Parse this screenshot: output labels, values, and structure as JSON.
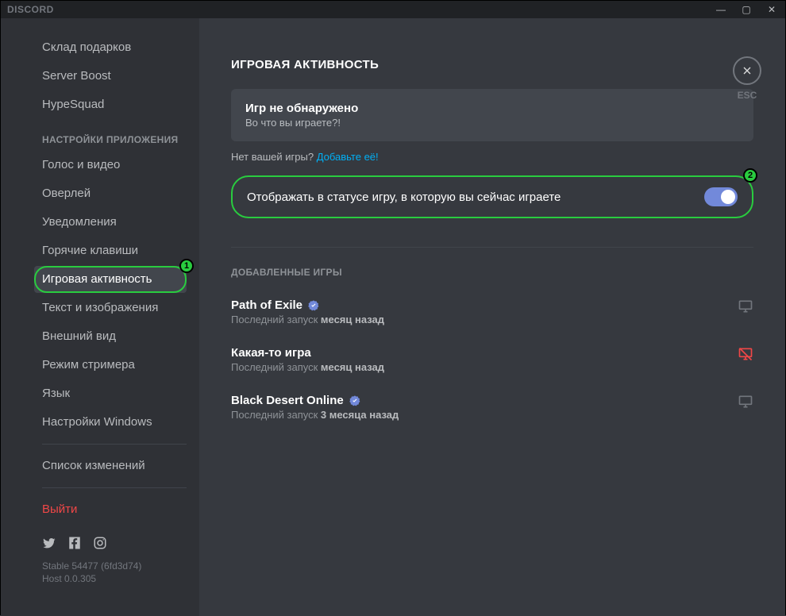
{
  "brand": "DISCORD",
  "window": {
    "min": "—",
    "max": "▢",
    "close": "✕"
  },
  "close": {
    "esc": "ESC"
  },
  "sidebar": {
    "top_items": [
      "Склад подарков",
      "Server Boost",
      "HypeSquad"
    ],
    "app_settings_header": "НАСТРОЙКИ ПРИЛОЖЕНИЯ",
    "app_items": [
      "Голос и видео",
      "Оверлей",
      "Уведомления",
      "Горячие клавиши",
      "Игровая активность",
      "Текст и изображения",
      "Внешний вид",
      "Режим стримера",
      "Язык",
      "Настройки Windows"
    ],
    "selected_index": 4,
    "changelog": "Список изменений",
    "logout": "Выйти",
    "build_line1": "Stable 54477 (6fd3d74)",
    "build_line2": "Host 0.0.305"
  },
  "badges": {
    "one": "1",
    "two": "2"
  },
  "page": {
    "title": "ИГРОВАЯ АКТИВНОСТЬ",
    "nogame_title": "Игр не обнаружено",
    "nogame_sub": "Во что вы играете?!",
    "ask_prefix": "Нет вашей игры? ",
    "ask_link": "Добавьте её!",
    "toggle_label": "Отображать в статусе игру, в которую вы сейчас играете",
    "added_header": "ДОБАВЛЕННЫЕ ИГРЫ",
    "meta_prefix": "Последний запуск ",
    "games": [
      {
        "name": "Path of Exile",
        "verified": true,
        "last": "месяц назад",
        "overlay": "on"
      },
      {
        "name": "Какая-то игра",
        "verified": false,
        "last": "месяц назад",
        "overlay": "off"
      },
      {
        "name": "Black Desert Online",
        "verified": true,
        "last": "3 месяца назад",
        "overlay": "on"
      }
    ]
  }
}
